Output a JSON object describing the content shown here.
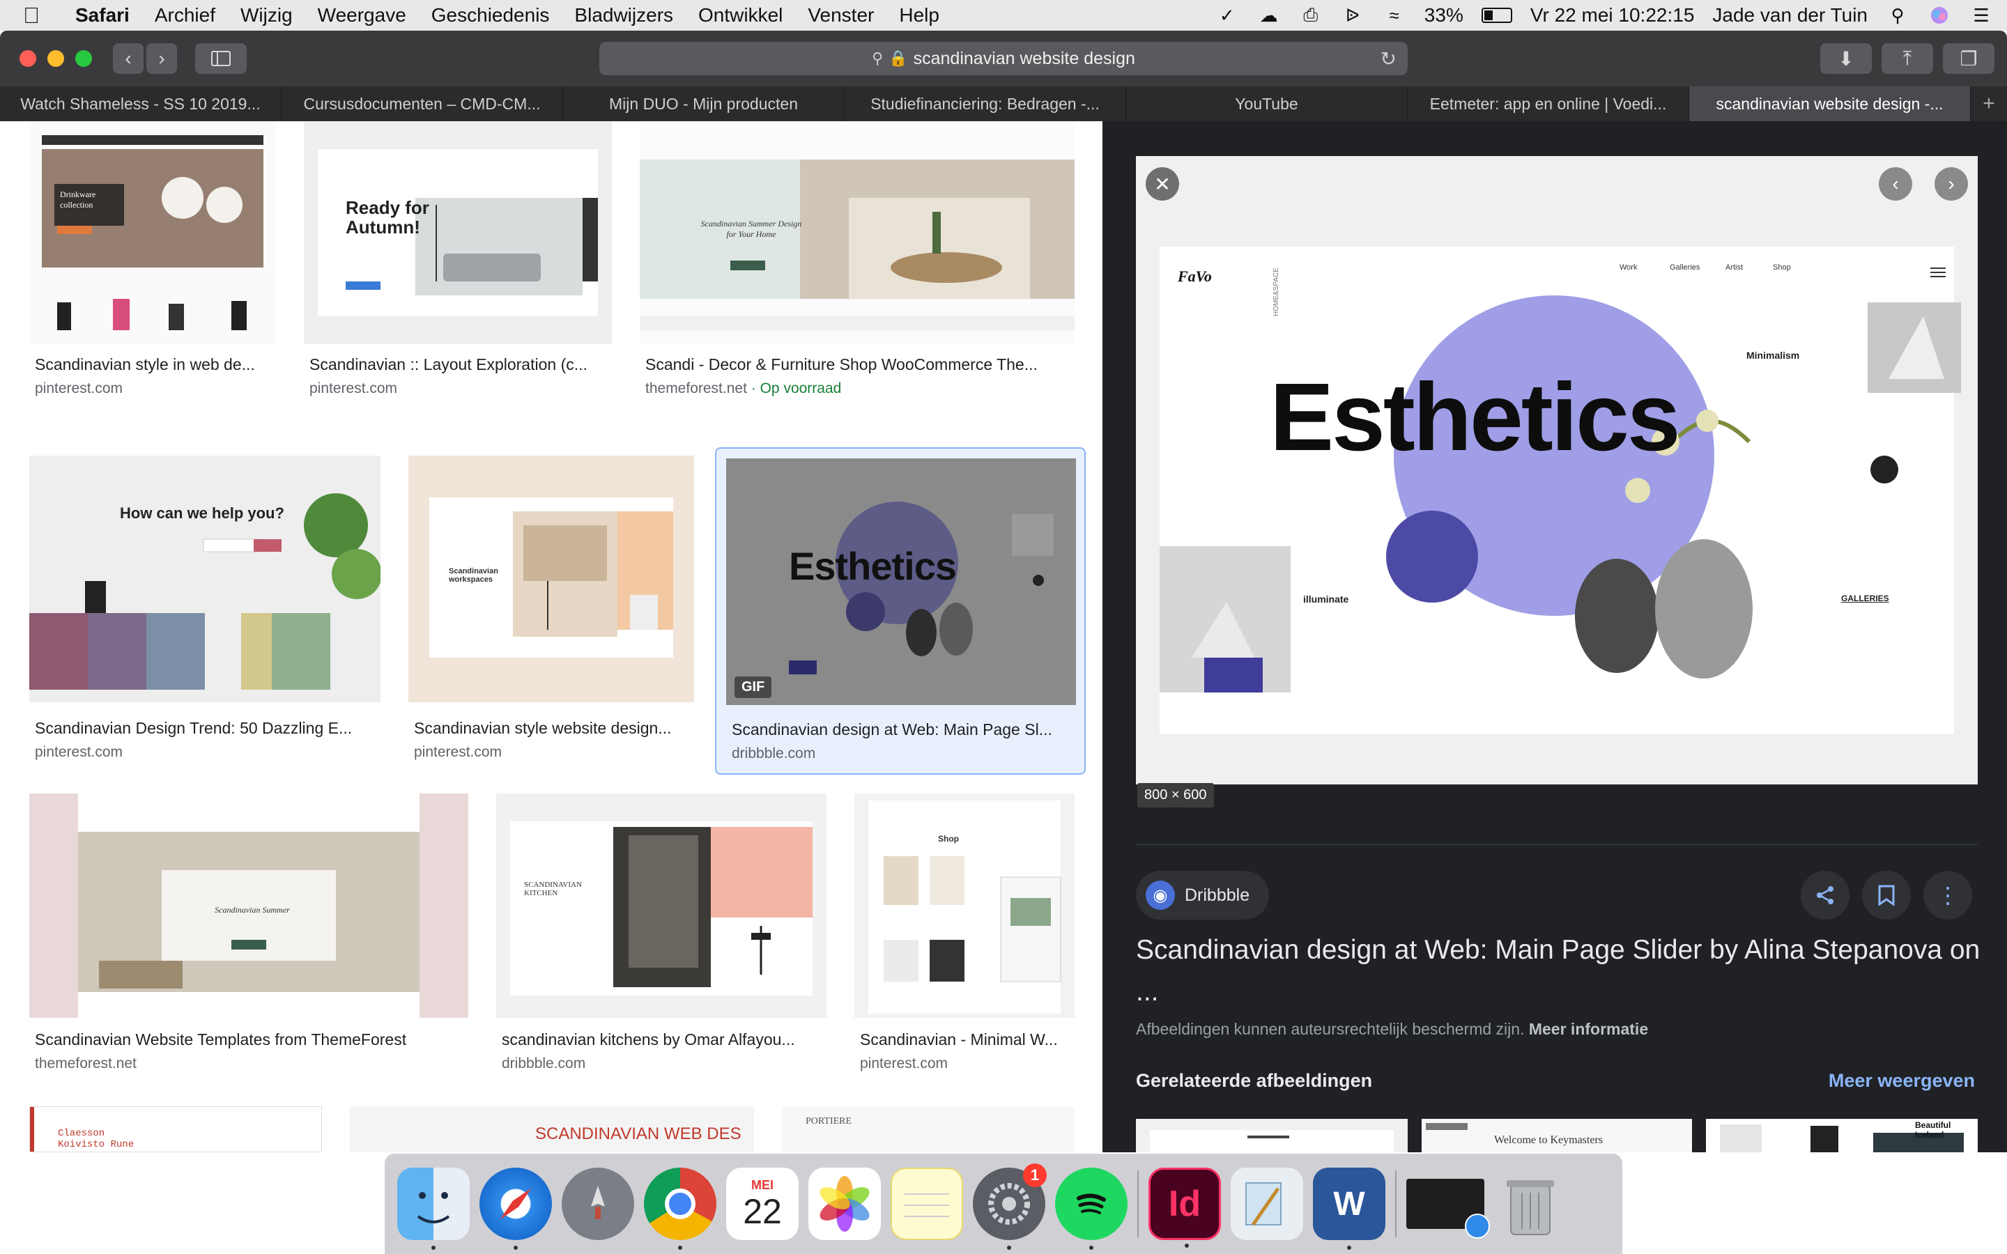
{
  "menubar": {
    "app_name": "Safari",
    "items": [
      "Archief",
      "Wijzig",
      "Weergave",
      "Geschiedenis",
      "Bladwijzers",
      "Ontwikkel",
      "Venster",
      "Help"
    ],
    "battery": "33%",
    "battery_level": 0.33,
    "datetime": "Vr 22 mei  10:22:15",
    "user": "Jade van der Tuin"
  },
  "browser": {
    "url": "scandinavian website design",
    "tabs": [
      "Watch Shameless - SS 10 2019...",
      "Cursusdocumenten – CMD-CM...",
      "Mijn DUO - Mijn producten",
      "Studiefinanciering: Bedragen -...",
      "YouTube",
      "Eetmeter: app en online | Voedi...",
      "scandinavian website design -..."
    ],
    "active_tab": 6
  },
  "results": [
    {
      "title": "Scandinavian style in web de...",
      "site": "pinterest.com",
      "thumb_text": "Drinkware collection"
    },
    {
      "title": "Scandinavian :: Layout Exploration (c...",
      "site": "pinterest.com",
      "thumb_text": "Ready for Autumn!"
    },
    {
      "title": "Scandi - Decor & Furniture Shop WooCommerce The...",
      "site": "themeforest.net",
      "site_extra": "· Op voorraad",
      "thumb_text": "Scandinavian Summer Design for Your Home"
    },
    {
      "title": "Scandinavian Design Trend: 50 Dazzling E...",
      "site": "pinterest.com",
      "thumb_text": "How can we help you?"
    },
    {
      "title": "Scandinavian style website design...",
      "site": "pinterest.com",
      "thumb_text": "Scandinavian workspaces"
    },
    {
      "title": "Scandinavian design at Web: Main Page Sl...",
      "site": "dribbble.com",
      "thumb_text": "Esthetics",
      "badge": "GIF"
    },
    {
      "title": "Scandinavian Website Templates from ThemeForest",
      "site": "themeforest.net",
      "thumb_text": "Scandinavian Summer"
    },
    {
      "title": "scandinavian kitchens by Omar Alfayou...",
      "site": "dribbble.com",
      "thumb_text": "SCANDINAVIAN KITCHEN"
    },
    {
      "title": "Scandinavian - Minimal W...",
      "site": "pinterest.com",
      "thumb_text": "Shop"
    },
    {
      "title": "",
      "site": "",
      "thumb_text": "Claesson Koivisto Rune"
    },
    {
      "title": "",
      "site": "",
      "thumb_text": "SCANDINAVIAN WEB DES"
    },
    {
      "title": "",
      "site": "",
      "thumb_text": "PORTIERE"
    }
  ],
  "preview": {
    "image_word": "Esthetics",
    "image_labels": {
      "minimalism": "Minimalism",
      "illuminate": "illuminate",
      "galleries": "GALLERIES",
      "home_space": "HOME&SPACE",
      "nav": [
        "Work",
        "Galleries",
        "Artist",
        "Shop"
      ]
    },
    "dimensions": "800 × 600",
    "source": "Dribbble",
    "title": "Scandinavian design at Web: Main Page Slider by Alina Stepanova on ...",
    "copyright_text": "Afbeeldingen kunnen auteursrechtelijk beschermd zijn.",
    "more_info": "Meer informatie",
    "related_heading": "Gerelateerde afbeeldingen",
    "related_more": "Meer weergeven",
    "related_texts": [
      "",
      "Welcome to Keymasters",
      "Beautiful Iceland"
    ]
  },
  "dock": {
    "calendar_month": "MEI",
    "calendar_day": "22",
    "system_prefs_badge": "1",
    "indesign_label": "Id",
    "word_label": "W"
  }
}
